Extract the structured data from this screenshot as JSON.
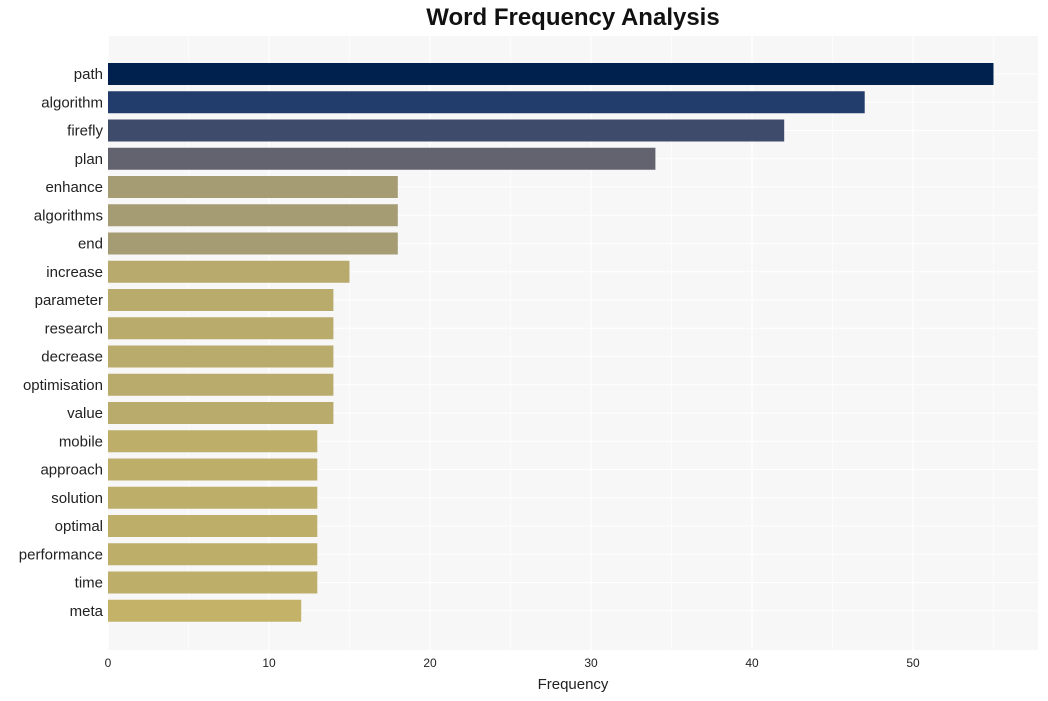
{
  "chart_data": {
    "type": "bar",
    "orientation": "horizontal",
    "title": "Word Frequency Analysis",
    "xlabel": "Frequency",
    "ylabel": "",
    "xlim": [
      0,
      57.5
    ],
    "xticks": [
      0,
      10,
      20,
      30,
      40,
      50
    ],
    "grid": true,
    "legend": "none",
    "categories": [
      "path",
      "algorithm",
      "firefly",
      "plan",
      "enhance",
      "algorithms",
      "end",
      "increase",
      "parameter",
      "research",
      "decrease",
      "optimisation",
      "value",
      "mobile",
      "approach",
      "solution",
      "optimal",
      "performance",
      "time",
      "meta"
    ],
    "values": [
      55,
      47,
      42,
      34,
      18,
      18,
      18,
      15,
      14,
      14,
      14,
      14,
      14,
      13,
      13,
      13,
      13,
      13,
      13,
      12
    ],
    "colors": [
      "#00204e",
      "#223c6b",
      "#3e4b6b",
      "#63636f",
      "#a59c73",
      "#a59c73",
      "#a59c73",
      "#b8aa6c",
      "#b9ab6c",
      "#b9ab6c",
      "#b9ab6c",
      "#b9ab6c",
      "#b9ab6c",
      "#bdae6a",
      "#bdae6a",
      "#bdae6a",
      "#bdae6a",
      "#bdae6a",
      "#bdae6a",
      "#c4b268"
    ]
  }
}
